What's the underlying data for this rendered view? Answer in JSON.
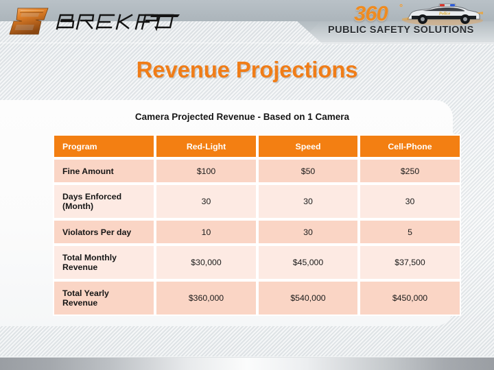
{
  "branding": {
    "brekford_wordmark": "BREKFORD",
    "brekford_mark": "brekford-b-monogram",
    "psafety_number": "360",
    "psafety_degree": "°",
    "psafety_tagline": "PUBLIC SAFETY SOLUTIONS",
    "psafety_vehicle": "police-car",
    "accent_color": "#f07d18",
    "table_header_color": "#f37f12",
    "row_shade_dark": "#fad5c5",
    "row_shade_light": "#fdeae3"
  },
  "slide": {
    "title": "Revenue Projections",
    "table_subtitle": "Camera Projected Revenue - Based on 1 Camera"
  },
  "table": {
    "columns": [
      "Program",
      "Red-Light",
      "Speed",
      "Cell-Phone"
    ],
    "rows": [
      {
        "label": "Fine Amount",
        "values": [
          "$100",
          "$50",
          "$250"
        ]
      },
      {
        "label": "Days Enforced (Month)",
        "values": [
          "30",
          "30",
          "30"
        ]
      },
      {
        "label": "Violators Per day",
        "values": [
          "10",
          "30",
          "5"
        ]
      },
      {
        "label": "Total Monthly Revenue",
        "values": [
          "$30,000",
          "$45,000",
          "$37,500"
        ]
      },
      {
        "label": "Total Yearly Revenue",
        "values": [
          "$360,000",
          "$540,000",
          "$450,000"
        ]
      }
    ]
  }
}
